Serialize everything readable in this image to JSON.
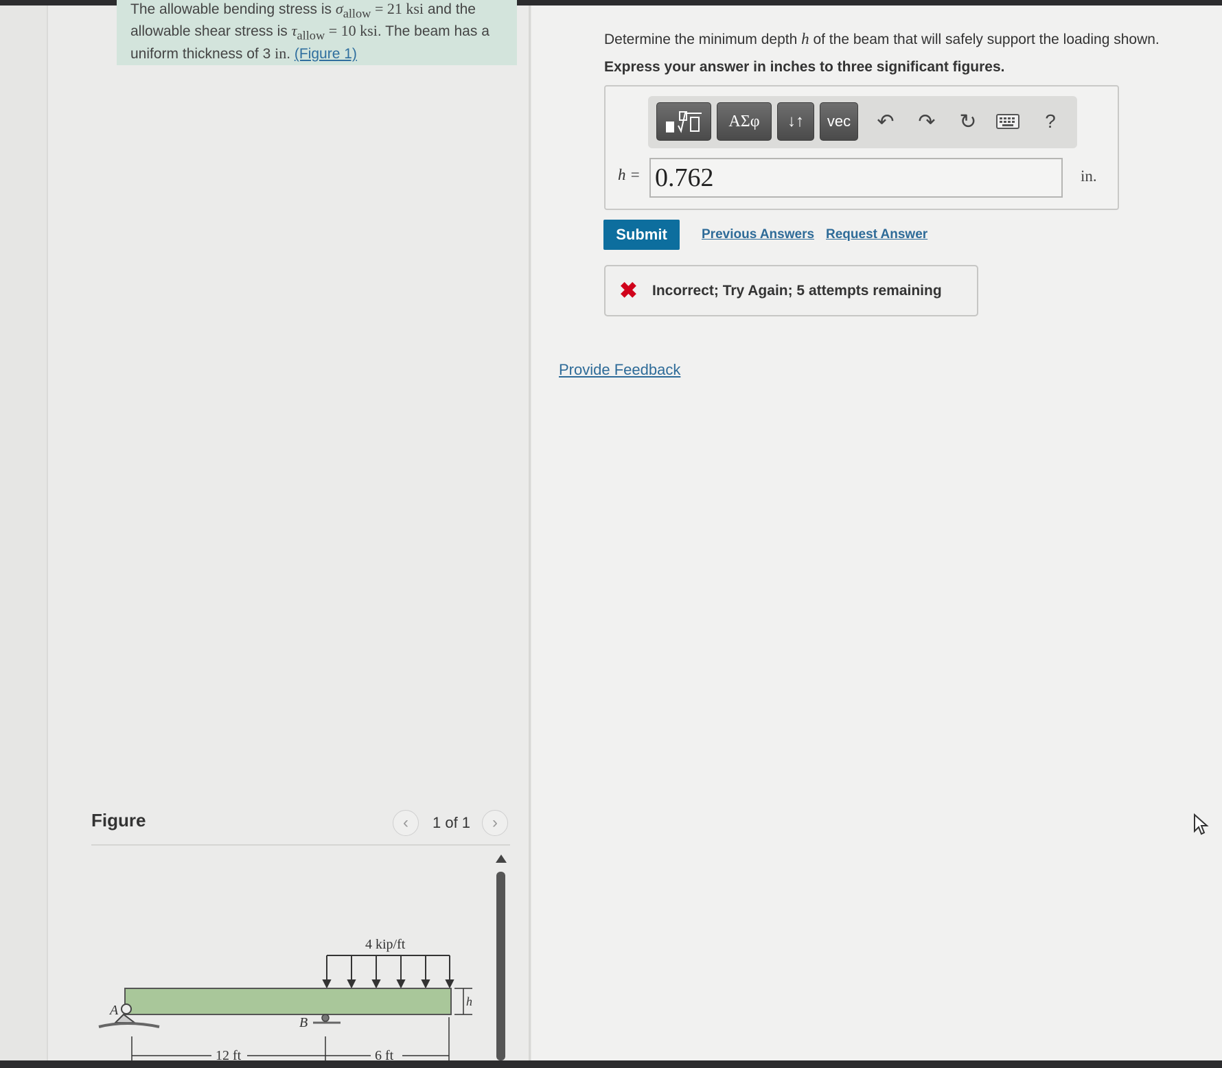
{
  "intro": {
    "line1_pre": "The allowable bending stress is ",
    "sigma": "σ",
    "sigma_sub": "allow",
    "line1_mid": " = 21 ",
    "ksi1": "ksi",
    "line1_post": " and the",
    "line2_pre": "allowable shear stress is ",
    "tau": "τ",
    "tau_sub": "allow",
    "line2_mid": " = 10 ",
    "ksi2": "ksi",
    "line2_post": ". The beam has a",
    "line3_pre": "uniform thickness of 3 ",
    "inch": "in",
    "line3_post": ". ",
    "figure_link": "(Figure 1)"
  },
  "question": {
    "pre": "Determine the minimum depth ",
    "var": "h",
    "post": " of the beam that will safely support the loading shown.",
    "instruction": "Express your answer in inches to three significant figures."
  },
  "toolbar": {
    "greek_label": "ΑΣφ",
    "arrows_label": "↓↑",
    "vec_label": "vec",
    "undo_icon": "↶",
    "redo_icon": "↷",
    "reset_icon": "↻",
    "help_label": "?"
  },
  "answer": {
    "var_label": "h =",
    "value": "0.762",
    "unit": "in."
  },
  "actions": {
    "submit": "Submit",
    "previous_answers": "Previous Answers",
    "request_answer": "Request Answer"
  },
  "feedback": {
    "icon": "✖",
    "text": "Incorrect; Try Again; 5 attempts remaining"
  },
  "provide_feedback": "Provide Feedback",
  "figure": {
    "title": "Figure",
    "counter": "1 of 1",
    "prev_icon": "‹",
    "next_icon": "›",
    "load_label": "4 kip/ft",
    "label_a": "A",
    "label_b": "B",
    "label_h": "h",
    "dim1": "12 ft",
    "dim2": "6 ft"
  },
  "colors": {
    "beam_fill": "#a9c79a",
    "submit_bg": "#0d6e9e",
    "link": "#2e6b98",
    "error": "#d0021b",
    "intro_bg": "#d3e4dc"
  }
}
